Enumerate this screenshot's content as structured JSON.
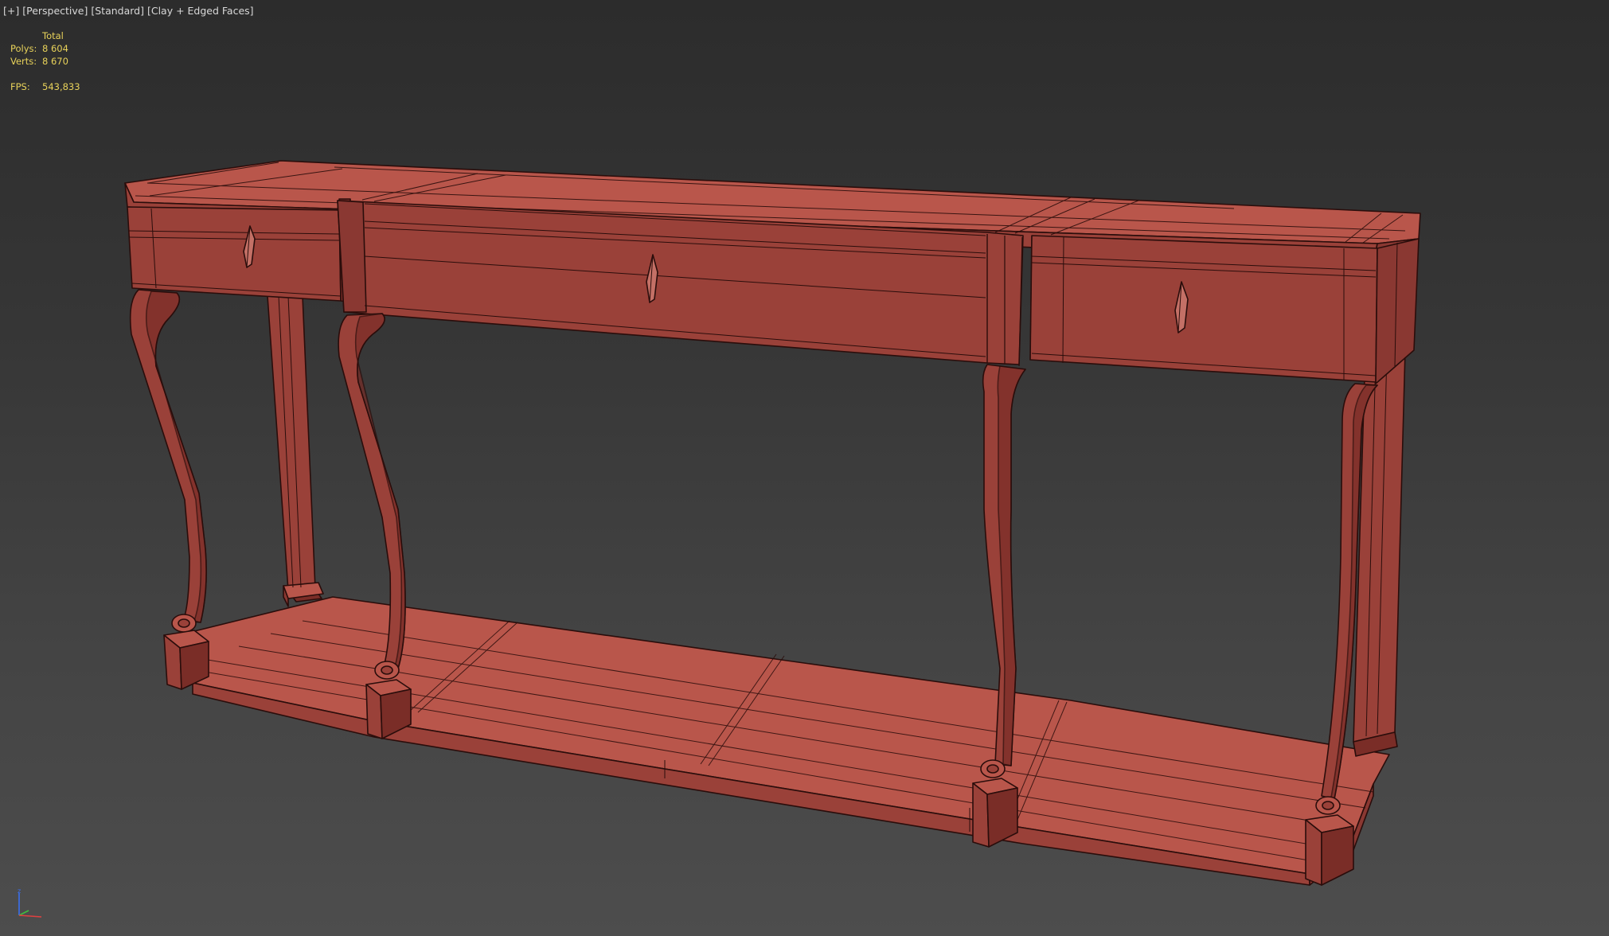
{
  "viewport": {
    "labels": {
      "plus": "[+]",
      "view": "[Perspective]",
      "shading_preset": "[Standard]",
      "display_mode": "[Clay + Edged Faces]"
    },
    "stats": {
      "header": "Total",
      "polys_label": "Polys:",
      "polys_value": "8 604",
      "verts_label": "Verts:",
      "verts_value": "8 670",
      "fps_label": "FPS:",
      "fps_value": "543,833"
    },
    "colors": {
      "background_top": "#2c2c2c",
      "background_bottom": "#4d4d4d",
      "clay_light": "#b9564b",
      "clay_mid": "#9a4139",
      "clay_dark": "#7a2d27",
      "edge": "#2a0d0b",
      "stats_text": "#e8d25a",
      "label_text": "#d8d8d8"
    },
    "object": "console-table",
    "gizmo": {
      "axes": [
        "z",
        "y",
        "x"
      ],
      "axis_colors": [
        "#3a6ff0",
        "#3fbf3f",
        "#e04040"
      ]
    }
  }
}
